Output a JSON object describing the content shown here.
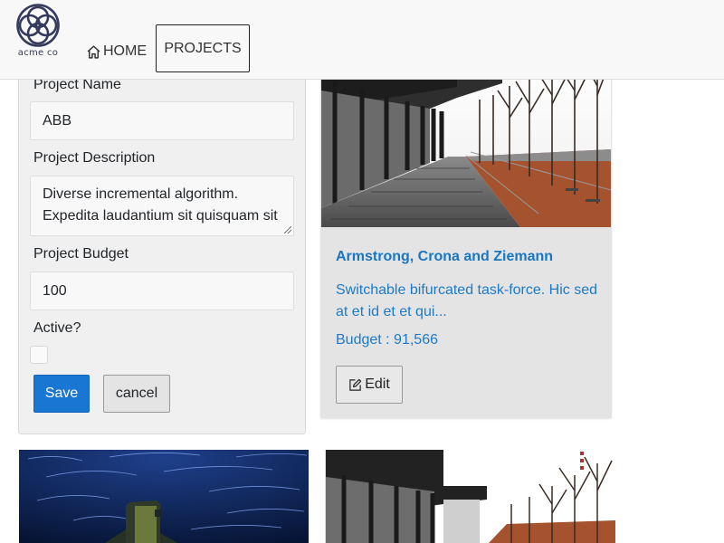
{
  "brand": {
    "name": "acme co"
  },
  "nav": {
    "home_label": "HOME",
    "projects_label": "PROJECTS"
  },
  "form": {
    "name_label": "Project Name",
    "name_value": "ABB",
    "description_label": "Project Description",
    "description_value": "Diverse incremental algorithm. Expedita laudantium sit quisquam sit",
    "budget_label": "Project Budget",
    "budget_value": "100",
    "active_label": "Active?",
    "active_checked": false,
    "save_label": "Save",
    "cancel_label": "cancel"
  },
  "card": {
    "title": "Armstrong, Crona and Ziemann",
    "description": "Switchable bifurcated task-force. Hic sed at et id et et qui...",
    "budget": "Budget : 91,566",
    "edit_label": "Edit"
  },
  "colors": {
    "accent": "#1976d2",
    "link": "#1e7ac8",
    "panel_bg": "#f0f0f0",
    "card_bg": "#e4e4e4"
  },
  "icons": {
    "home": "home-icon",
    "edit": "edit-icon",
    "logo": "interlocking-circles-logo"
  }
}
